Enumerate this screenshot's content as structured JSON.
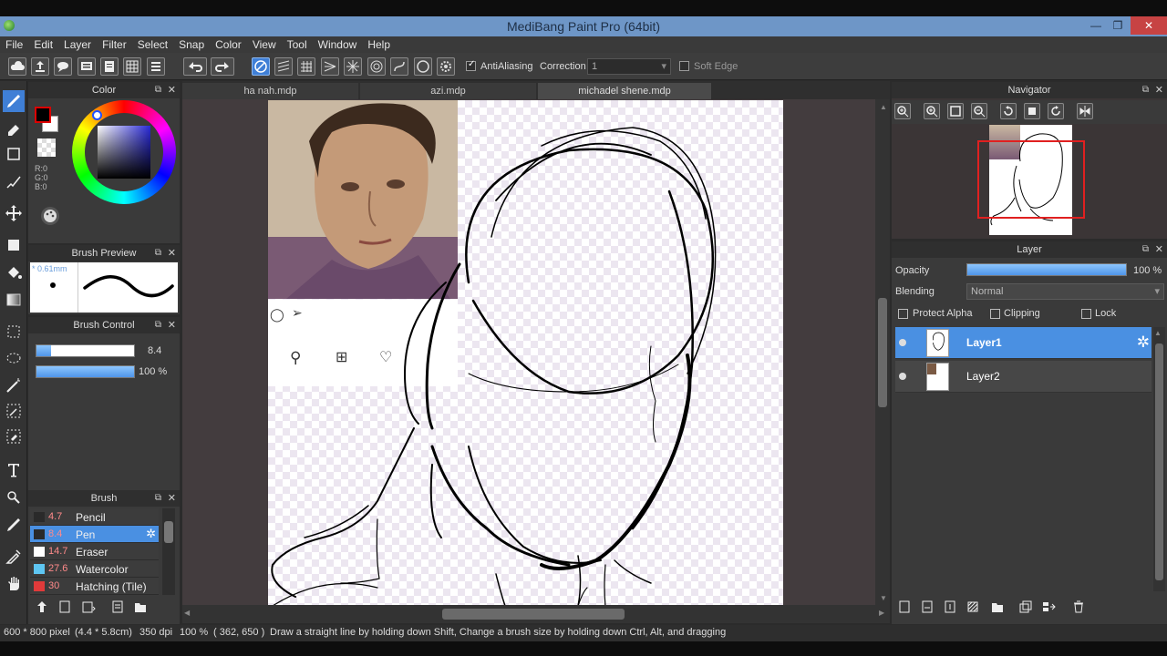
{
  "window": {
    "title": "MediBang Paint Pro (64bit)"
  },
  "menu": [
    "File",
    "Edit",
    "Layer",
    "Filter",
    "Select",
    "Snap",
    "Color",
    "View",
    "Tool",
    "Window",
    "Help"
  ],
  "toolbar": {
    "antialiasing_label": "AntiAliasing",
    "correction_label": "Correction",
    "correction_value": "1",
    "soft_edge_label": "Soft Edge"
  },
  "color_panel": {
    "title": "Color",
    "r": "R:0",
    "g": "G:0",
    "b": "B:0",
    "primary_color": "#000000",
    "secondary_color": "#ffffff"
  },
  "brush_preview": {
    "title": "Brush Preview",
    "size_label": "0.61mm"
  },
  "brush_control": {
    "title": "Brush Control",
    "size_value": "8.4",
    "size_fraction": 0.15,
    "opacity_value": "100 %",
    "opacity_fraction": 1.0
  },
  "brush_panel": {
    "title": "Brush",
    "items": [
      {
        "size": "4.7",
        "name": "Pencil",
        "color": "#2a2a2a"
      },
      {
        "size": "8.4",
        "name": "Pen",
        "color": "#2a2a2a"
      },
      {
        "size": "14.7",
        "name": "Eraser",
        "color": "#ffffff"
      },
      {
        "size": "27.6",
        "name": "Watercolor",
        "color": "#5ec6f2"
      },
      {
        "size": "30",
        "name": "Hatching (Tile)",
        "color": "#e03a3a"
      }
    ]
  },
  "tabs": [
    "ha nah.mdp",
    "azi.mdp",
    "michadel shene.mdp"
  ],
  "navigator": {
    "title": "Navigator"
  },
  "layer_panel": {
    "title": "Layer",
    "opacity_label": "Opacity",
    "opacity_value": "100 %",
    "opacity_fraction": 1.0,
    "blending_label": "Blending",
    "blending_value": "Normal",
    "protect_alpha_label": "Protect Alpha",
    "clipping_label": "Clipping",
    "lock_label": "Lock",
    "layers": [
      {
        "name": "Layer1"
      },
      {
        "name": "Layer2"
      }
    ]
  },
  "statusbar": {
    "canvas_size": "600 * 800 pixel",
    "physical_size": "(4.4 * 5.8cm)",
    "dpi": "350 dpi",
    "zoom": "100 %",
    "cursor": "( 362, 650 )",
    "hint": "Draw a straight line by holding down Shift, Change a brush size by holding down Ctrl, Alt, and dragging"
  }
}
